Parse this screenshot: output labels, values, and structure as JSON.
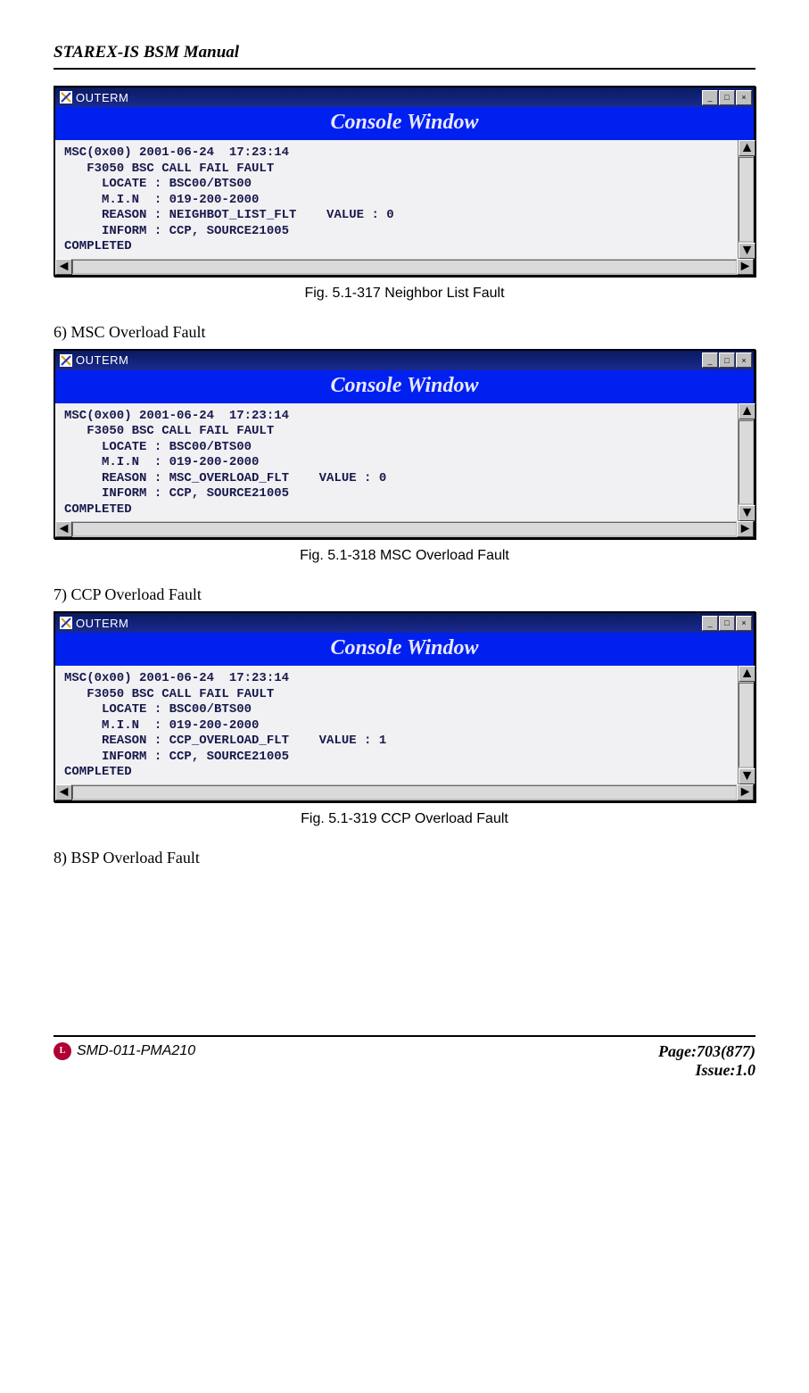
{
  "header": {
    "title": "STAREX-IS BSM Manual"
  },
  "windows": [
    {
      "titlebar": "OUTERM",
      "banner": "Console Window",
      "body": "MSC(0x00) 2001-06-24  17:23:14\n   F3050 BSC CALL FAIL FAULT\n     LOCATE : BSC00/BTS00\n     M.I.N  : 019-200-2000\n     REASON : NEIGHBOT_LIST_FLT    VALUE : 0\n     INFORM : CCP, SOURCE21005\nCOMPLETED"
    },
    {
      "titlebar": "OUTERM",
      "banner": "Console Window",
      "body": "MSC(0x00) 2001-06-24  17:23:14\n   F3050 BSC CALL FAIL FAULT\n     LOCATE : BSC00/BTS00\n     M.I.N  : 019-200-2000\n     REASON : MSC_OVERLOAD_FLT    VALUE : 0\n     INFORM : CCP, SOURCE21005\nCOMPLETED"
    },
    {
      "titlebar": "OUTERM",
      "banner": "Console Window",
      "body": "MSC(0x00) 2001-06-24  17:23:14\n   F3050 BSC CALL FAIL FAULT\n     LOCATE : BSC00/BTS00\n     M.I.N  : 019-200-2000\n     REASON : CCP_OVERLOAD_FLT    VALUE : 1\n     INFORM : CCP, SOURCE21005\nCOMPLETED"
    }
  ],
  "captions": [
    "Fig.    5.1-317 Neighbor List Fault",
    "Fig.    5.1-318 MSC Overload Fault",
    "Fig.    5.1-319 CCP Overload Fault"
  ],
  "body_items": [
    "6)   MSC Overload Fault",
    "7)   CCP Overload Fault",
    "8)   BSP Overload Fault"
  ],
  "footer": {
    "doc_id": "SMD-011-PMA210",
    "page": "Page:703(877)",
    "issue": "Issue:1.0"
  },
  "win_buttons": {
    "minimize": "_",
    "maximize": "□",
    "close": "×"
  },
  "scroll_icons": {
    "left": "◄",
    "right": "►",
    "up": "▲",
    "down": "▼"
  }
}
